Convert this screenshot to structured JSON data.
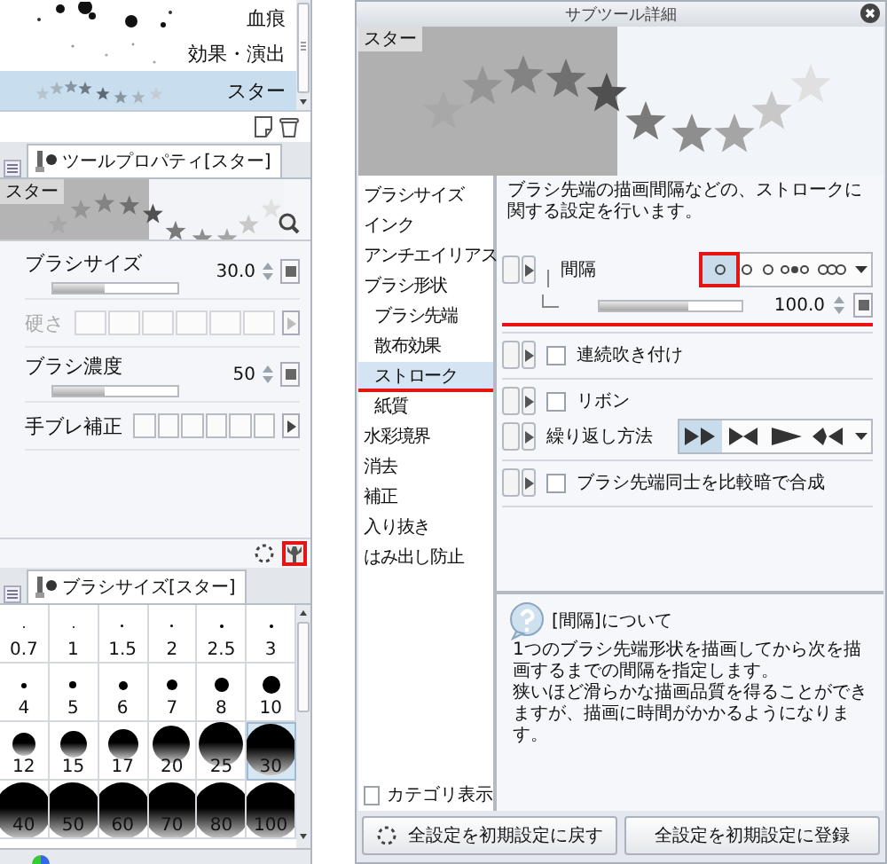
{
  "brush_list": {
    "items": [
      {
        "name": "血痕",
        "kind": "splatter",
        "selected": false
      },
      {
        "name": "効果・演出",
        "kind": "dots",
        "selected": false
      },
      {
        "name": "スター",
        "kind": "stars",
        "selected": true
      }
    ]
  },
  "tool_property": {
    "tab": "ツールプロパティ[スター]",
    "preview_label": "スター",
    "settings": [
      {
        "kind": "slider",
        "label": "ブラシサイズ",
        "value": "30.0",
        "level": 0.42
      },
      {
        "kind": "boxes",
        "label": "硬さ",
        "disabled": true
      },
      {
        "kind": "slider",
        "label": "ブラシ濃度",
        "value": "50",
        "level": 0.42
      },
      {
        "kind": "boxes",
        "label": "手ブレ補正",
        "disabled": false
      }
    ],
    "settings_button": {
      "highlighted": true
    }
  },
  "brush_size": {
    "tab": "ブラシサイズ[スター]",
    "sizes": [
      {
        "label": "0.7",
        "selected": false
      },
      {
        "label": "1",
        "selected": false
      },
      {
        "label": "1.5",
        "selected": false
      },
      {
        "label": "2",
        "selected": false
      },
      {
        "label": "2.5",
        "selected": false
      },
      {
        "label": "3",
        "selected": false
      },
      {
        "label": "4",
        "selected": false
      },
      {
        "label": "5",
        "selected": false
      },
      {
        "label": "6",
        "selected": false
      },
      {
        "label": "7",
        "selected": false
      },
      {
        "label": "8",
        "selected": false
      },
      {
        "label": "10",
        "selected": false
      },
      {
        "label": "12",
        "selected": false
      },
      {
        "label": "15",
        "selected": false
      },
      {
        "label": "17",
        "selected": false
      },
      {
        "label": "20",
        "selected": false
      },
      {
        "label": "25",
        "selected": false
      },
      {
        "label": "30",
        "selected": true
      },
      {
        "label": "40",
        "selected": false
      },
      {
        "label": "50",
        "selected": false
      },
      {
        "label": "60",
        "selected": false
      },
      {
        "label": "70",
        "selected": false
      },
      {
        "label": "80",
        "selected": false
      },
      {
        "label": "100",
        "selected": false
      }
    ]
  },
  "sub_tool_detail": {
    "title": "サブツール詳細",
    "preview_label": "スター",
    "categories": [
      {
        "label": "ブラシサイズ",
        "selected": false,
        "highlighted": false
      },
      {
        "label": "インク",
        "selected": false,
        "highlighted": false
      },
      {
        "label": "アンチエイリアス",
        "selected": false,
        "highlighted": false
      },
      {
        "label": "ブラシ形状",
        "selected": false,
        "highlighted": false,
        "children": [
          {
            "label": "ブラシ先端",
            "selected": false,
            "highlighted": false
          },
          {
            "label": "散布効果",
            "selected": false,
            "highlighted": false
          },
          {
            "label": "ストローク",
            "selected": true,
            "highlighted": true
          },
          {
            "label": "紙質",
            "selected": false,
            "highlighted": false
          }
        ]
      },
      {
        "label": "水彩境界",
        "selected": false,
        "highlighted": false
      },
      {
        "label": "消去",
        "selected": false,
        "highlighted": false
      },
      {
        "label": "補正",
        "selected": false,
        "highlighted": false
      },
      {
        "label": "入り抜き",
        "selected": false,
        "highlighted": false
      },
      {
        "label": "はみ出し防止",
        "selected": false,
        "highlighted": false
      }
    ],
    "category_display": {
      "label": "カテゴリ表示",
      "checked": false
    },
    "description": "ブラシ先端の描画間隔などの、ストロークに関する設定を行います。",
    "groups": [
      {
        "settings": [
          {
            "kind": "interval",
            "label": "間隔",
            "options": [
              {
                "selected": true,
                "highlighted": true
              },
              {
                "selected": false,
                "highlighted": false
              },
              {
                "selected": false,
                "highlighted": false
              },
              {
                "selected": false,
                "highlighted": false
              }
            ]
          },
          {
            "kind": "slider",
            "value": "100.0",
            "level": 0.62,
            "highlighted": true
          }
        ]
      },
      {
        "settings": [
          {
            "kind": "checkbox",
            "label": "連続吹き付け",
            "checked": false
          }
        ]
      },
      {
        "settings": [
          {
            "kind": "checkbox",
            "label": "リボン",
            "checked": false
          },
          {
            "kind": "repeat",
            "label": "繰り返し方法",
            "options": [
              {
                "selected": true
              },
              {
                "selected": false
              },
              {
                "selected": false
              },
              {
                "selected": false
              }
            ]
          }
        ]
      },
      {
        "settings": [
          {
            "kind": "checkbox",
            "label": "ブラシ先端同士を比較暗で合成",
            "checked": false
          }
        ]
      }
    ],
    "help": {
      "title": "[間隔]について",
      "paragraphs": [
        "1つのブラシ先端形状を描画してから次を描画するまでの間隔を指定します。",
        "狭いほど滑らかな描画品質を得ることができますが、描画に時間がかかるようになります。"
      ]
    },
    "buttons": [
      {
        "label": "全設定を初期設定に戻す",
        "kind": "reset"
      },
      {
        "label": "全設定を初期設定に登録",
        "kind": "register"
      }
    ]
  }
}
